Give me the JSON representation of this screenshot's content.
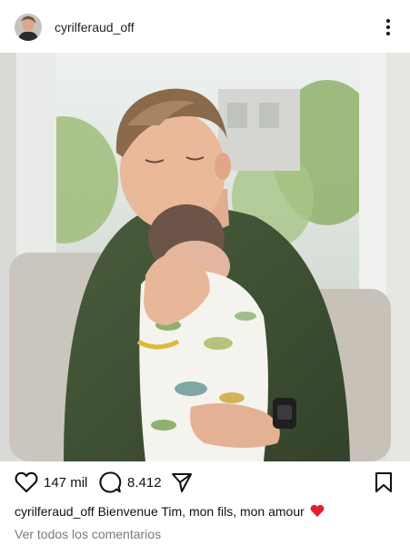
{
  "post": {
    "username": "cyrilferaud_off"
  },
  "actions": {
    "likes_count": "147 mil",
    "comments_count": "8.412"
  },
  "caption": {
    "username": "cyrilferaud_off",
    "text": "Bienvenue Tim, mon fils, mon amour"
  },
  "comments_link": "Ver todos los comentarios",
  "icons": {
    "more": "more-vertical-icon",
    "like": "heart-outline-icon",
    "comment": "comment-bubble-icon",
    "share": "paper-plane-icon",
    "save": "bookmark-outline-icon",
    "caption_emoji": "red-heart-emoji"
  },
  "colors": {
    "emoji_red": "#e0212e",
    "muted_text": "#7a7a7a"
  }
}
